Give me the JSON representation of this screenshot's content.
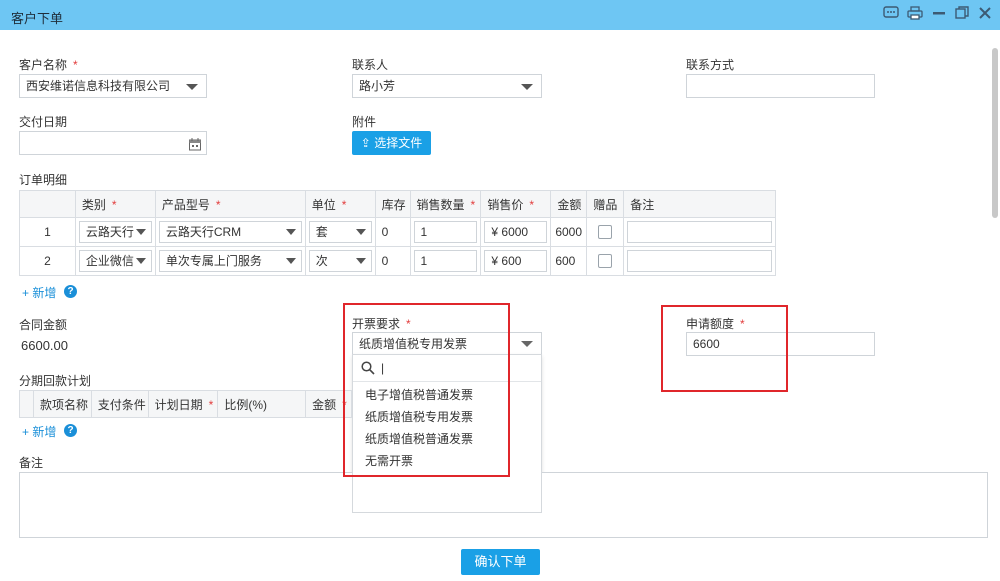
{
  "window": {
    "title": "客户下单",
    "controls": [
      "chat-icon",
      "print-icon",
      "minimize-icon",
      "restore-icon",
      "close-icon"
    ]
  },
  "customer": {
    "label": "客户名称",
    "required": "*",
    "value": "西安维诺信息科技有限公司"
  },
  "contact": {
    "label": "联系人",
    "value": "路小芳"
  },
  "contact_method": {
    "label": "联系方式",
    "value": ""
  },
  "delivery_date": {
    "label": "交付日期",
    "value": ""
  },
  "attachment": {
    "label": "附件",
    "button": "选择文件"
  },
  "order_details": {
    "label": "订单明细",
    "columns": [
      {
        "label": "",
        "required": ""
      },
      {
        "label": "类别",
        "required": "*"
      },
      {
        "label": "产品型号",
        "required": "*"
      },
      {
        "label": "单位",
        "required": "*"
      },
      {
        "label": "库存",
        "required": ""
      },
      {
        "label": "销售数量",
        "required": "*"
      },
      {
        "label": "销售价",
        "required": "*"
      },
      {
        "label": "金额",
        "required": ""
      },
      {
        "label": "赠品",
        "required": ""
      },
      {
        "label": "备注",
        "required": ""
      }
    ],
    "rows": [
      {
        "no": "1",
        "category": "云路天行",
        "model": "云路天行CRM",
        "unit": "套",
        "stock": "0",
        "qty": "1",
        "price": "¥ 6000",
        "amount": "6000",
        "remark": ""
      },
      {
        "no": "2",
        "category": "企业微信",
        "model": "单次专属上门服务",
        "unit": "次",
        "stock": "0",
        "qty": "1",
        "price": "¥ 600",
        "amount": "600",
        "remark": ""
      }
    ],
    "add_label": "+ 新增",
    "help": "?"
  },
  "contract_amount": {
    "label": "合同金额",
    "value": "6600.00"
  },
  "invoice": {
    "label": "开票要求",
    "required": "*",
    "value": "纸质增值税专用发票",
    "search_icon": "search-icon",
    "search_value": "|",
    "options": [
      "电子增值税普通发票",
      "纸质增值税专用发票",
      "纸质增值税普通发票",
      "无需开票"
    ]
  },
  "apply_amount": {
    "label": "申请额度",
    "required": "*",
    "value": "6600"
  },
  "installments": {
    "label": "分期回款计划",
    "columns": [
      {
        "label": "",
        "required": ""
      },
      {
        "label": "款项名称",
        "required": ""
      },
      {
        "label": "支付条件",
        "required": ""
      },
      {
        "label": "计划日期",
        "required": "*"
      },
      {
        "label": "比例(%)",
        "required": ""
      },
      {
        "label": "金额",
        "required": "*"
      }
    ],
    "add_label": "+ 新增",
    "help": "?"
  },
  "remarks": {
    "label": "备注",
    "value": ""
  },
  "submit": {
    "label": "确认下单"
  },
  "colors": {
    "titlebar": "#6ec6f3",
    "primary": "#1aa0e6",
    "required": "#e23c3c",
    "highlight": "#e0262b"
  }
}
